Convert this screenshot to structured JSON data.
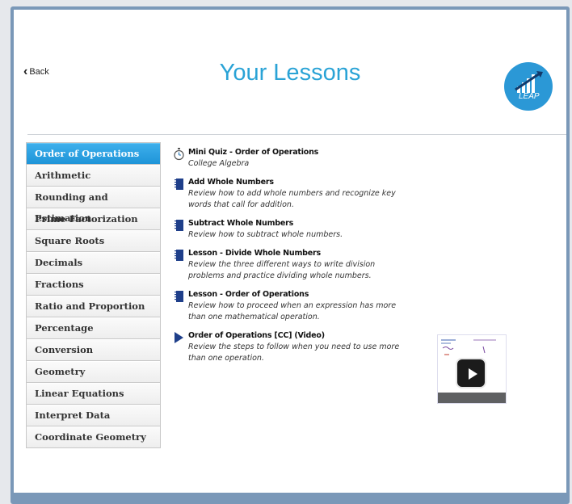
{
  "header": {
    "back_label": "Back",
    "title": "Your Lessons",
    "logo_text": "LEAP"
  },
  "sidebar": {
    "items": [
      {
        "label": "Order of Operations",
        "active": true
      },
      {
        "label": "Arithmetic"
      },
      {
        "label": "Rounding and Estimation"
      },
      {
        "label": "Prime Factorization"
      },
      {
        "label": "Square Roots"
      },
      {
        "label": "Decimals"
      },
      {
        "label": "Fractions"
      },
      {
        "label": "Ratio and Proportion"
      },
      {
        "label": "Percentage"
      },
      {
        "label": "Conversion"
      },
      {
        "label": "Geometry"
      },
      {
        "label": "Linear Equations"
      },
      {
        "label": "Interpret Data"
      },
      {
        "label": "Coordinate Geometry"
      }
    ]
  },
  "lessons": [
    {
      "icon": "stopwatch-icon",
      "title": "Mini Quiz - Order of Operations",
      "desc": "College Algebra"
    },
    {
      "icon": "notebook-icon",
      "title": "Add Whole Numbers",
      "desc": "Review how to add whole numbers and recognize key words that call for addition."
    },
    {
      "icon": "notebook-icon",
      "title": "Subtract Whole Numbers",
      "desc": "Review how to subtract whole numbers."
    },
    {
      "icon": "notebook-icon",
      "title": "Lesson - Divide Whole Numbers",
      "desc": "Review the three different ways to write division problems and practice dividing whole numbers."
    },
    {
      "icon": "notebook-icon",
      "title": "Lesson - Order of Operations",
      "desc": "Review how to proceed when an expression has more than one mathematical operation."
    },
    {
      "icon": "play-triangle-icon",
      "title": "Order of Operations [CC] (Video)",
      "desc": "Review the steps to follow when you need to use more than one operation."
    }
  ],
  "colors": {
    "accent": "#2aa3d6",
    "active_tab": "#1e94d8",
    "frame": "#7a98b8"
  }
}
